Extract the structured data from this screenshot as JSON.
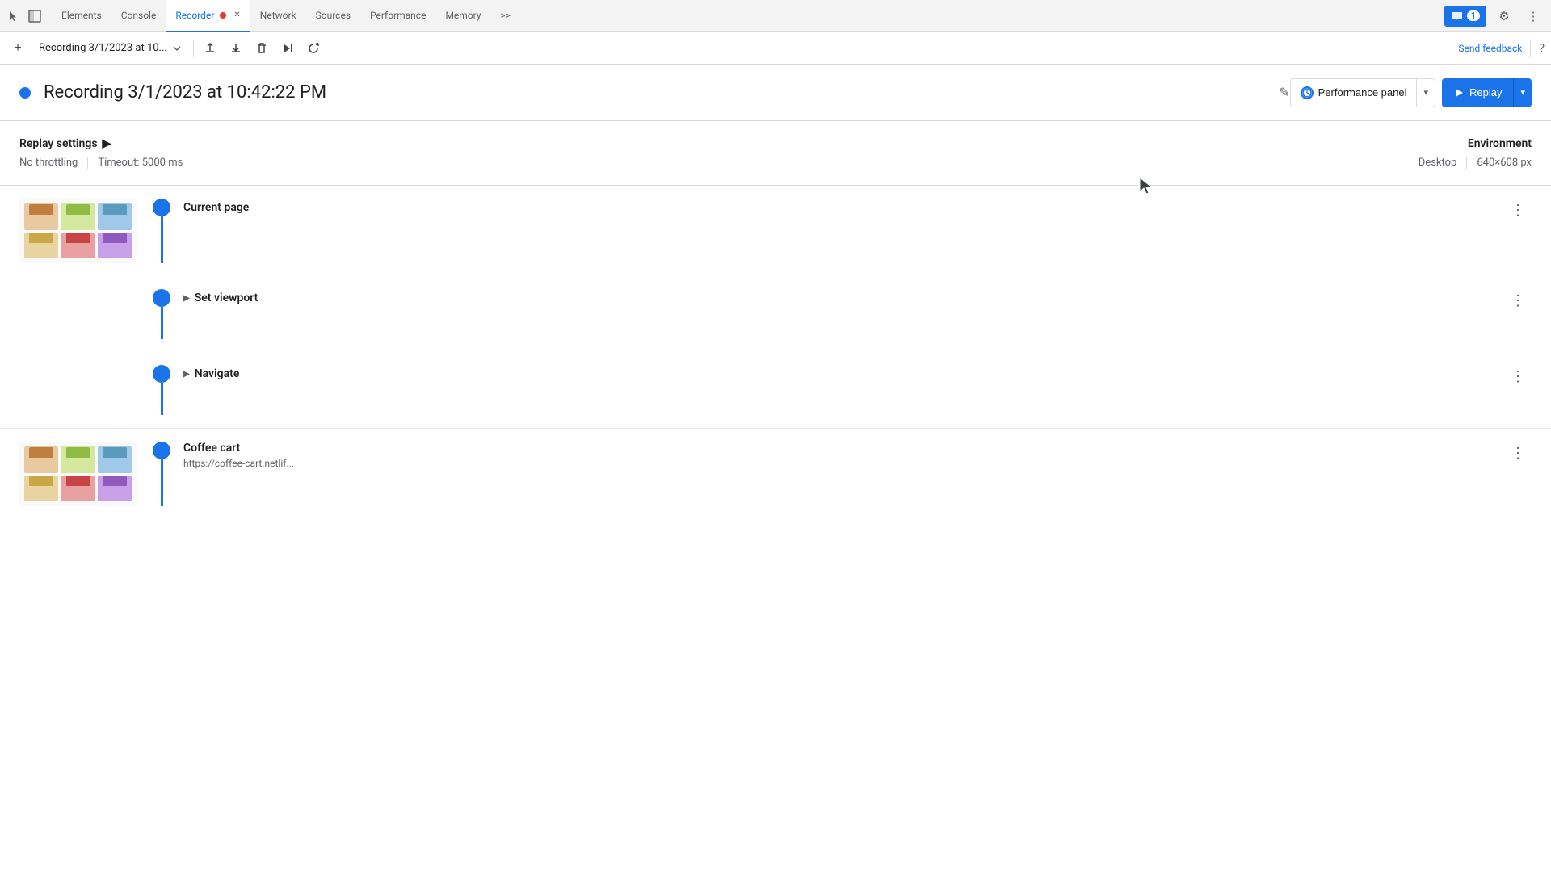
{
  "tabBar": {
    "tabs": [
      {
        "id": "elements",
        "label": "Elements",
        "active": false,
        "closable": false
      },
      {
        "id": "console",
        "label": "Console",
        "active": false,
        "closable": false
      },
      {
        "id": "recorder",
        "label": "Recorder",
        "active": true,
        "closable": true
      },
      {
        "id": "network",
        "label": "Network",
        "active": false,
        "closable": false
      },
      {
        "id": "sources",
        "label": "Sources",
        "active": false,
        "closable": false
      },
      {
        "id": "performance",
        "label": "Performance",
        "active": false,
        "closable": false
      },
      {
        "id": "memory",
        "label": "Memory",
        "active": false,
        "closable": false
      }
    ],
    "moreTabsLabel": ">>",
    "badge": {
      "count": "1"
    },
    "gearLabel": "⚙",
    "moreLabel": "⋮"
  },
  "toolbar": {
    "addLabel": "+",
    "recordingName": "Recording 3/1/2023 at 10...",
    "uploadLabel": "↑",
    "downloadLabel": "↓",
    "deleteLabel": "🗑",
    "playStepLabel": "▷|",
    "replayLabel": "↺",
    "sendFeedbackLabel": "Send feedback",
    "helpLabel": "?"
  },
  "recordingHeader": {
    "title": "Recording 3/1/2023 at 10:42:22 PM",
    "editIconLabel": "✎",
    "perfPanelLabel": "Performance panel",
    "replayLabel": "Replay",
    "dropdownArrow": "▾"
  },
  "settings": {
    "title": "Replay settings",
    "expandArrow": "▶",
    "throttling": "No throttling",
    "timeout": "Timeout: 5000 ms",
    "environment": {
      "title": "Environment",
      "device": "Desktop",
      "resolution": "640×608 px"
    }
  },
  "steps": [
    {
      "id": "current-page",
      "hasThumb": true,
      "label": "Current page",
      "expandable": false,
      "isFirst": true
    },
    {
      "id": "set-viewport",
      "hasThumb": false,
      "label": "Set viewport",
      "expandable": true
    },
    {
      "id": "navigate",
      "hasThumb": false,
      "label": "Navigate",
      "expandable": true
    }
  ],
  "coffeeCart": {
    "label": "Coffee cart",
    "url": "https://coffee-cart.netlif..."
  },
  "colors": {
    "accent": "#1a73e8",
    "border": "#dadada",
    "text": "#1f1f1f",
    "muted": "#5f6368"
  }
}
